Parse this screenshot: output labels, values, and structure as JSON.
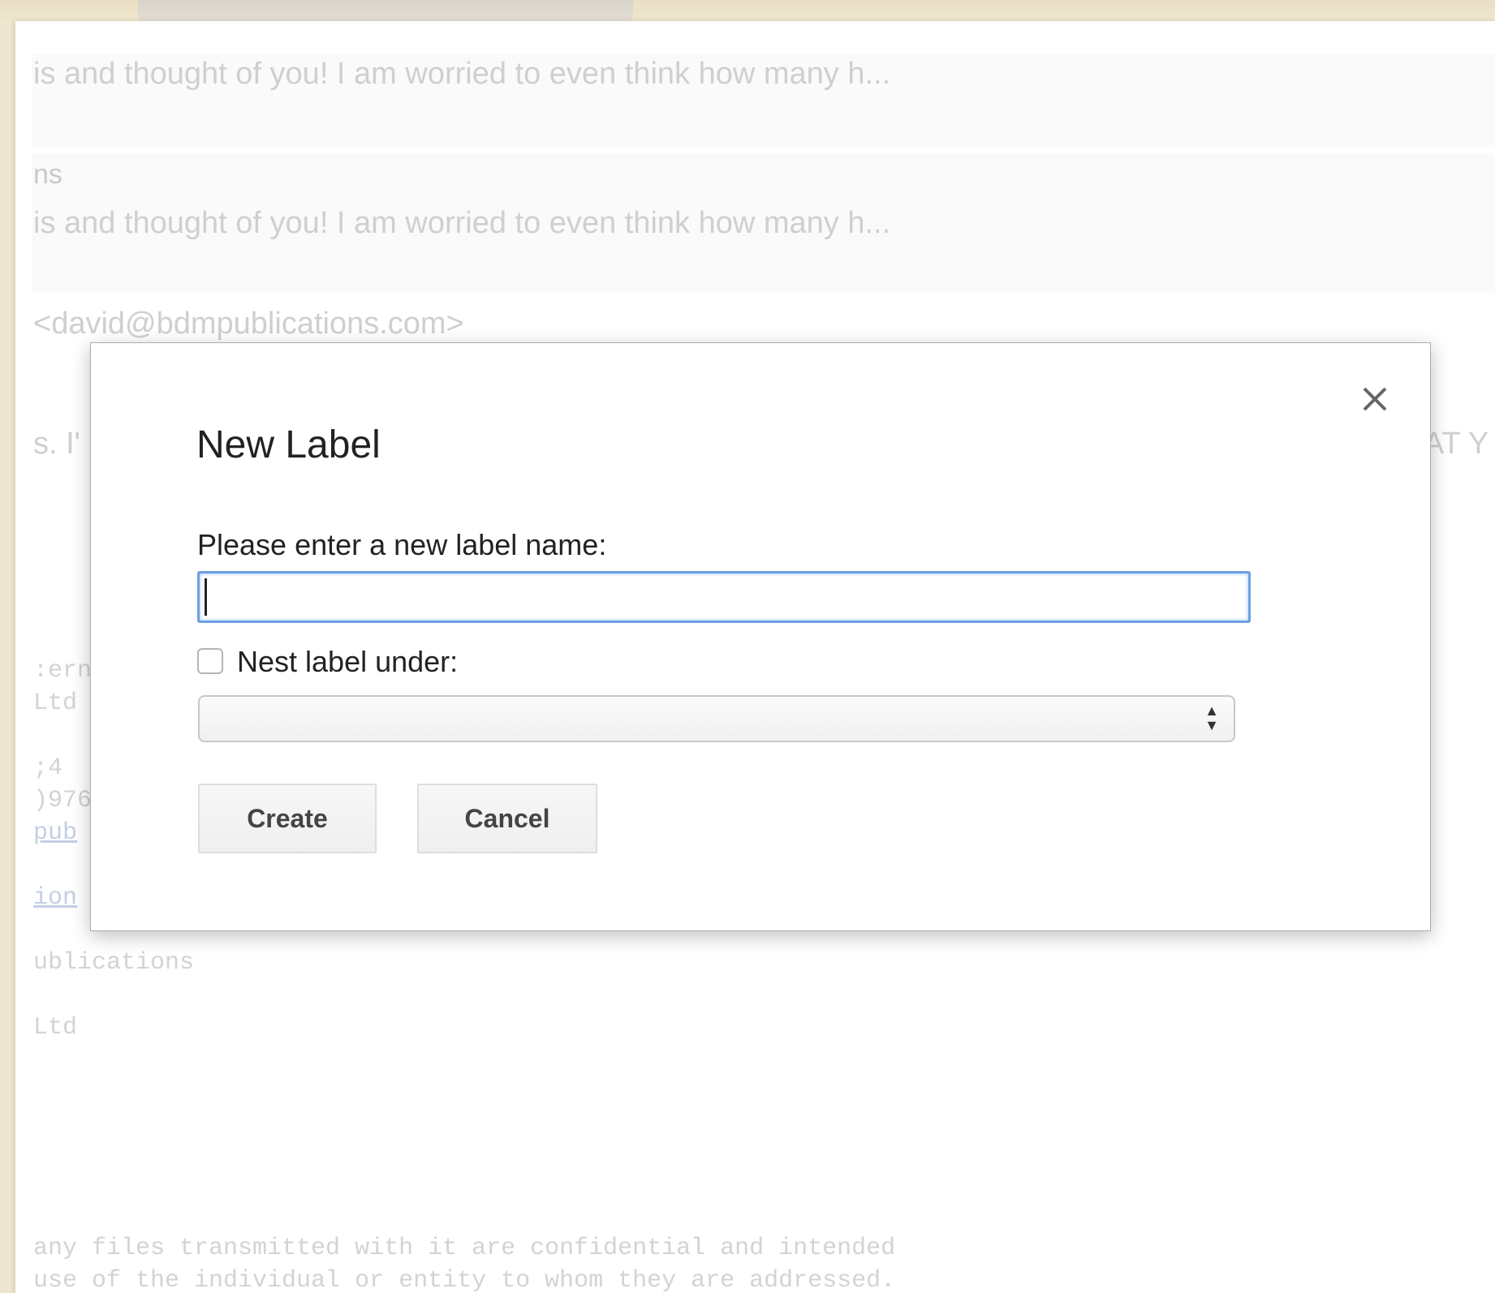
{
  "background": {
    "line1": "is and thought of you! I am worried to even think how many h...",
    "line2": "ns",
    "line3": "is and thought of you! I am worried to even think how many h...",
    "line4": "<david@bdmpublications.com>",
    "line5_left": "s. I'",
    "line5_right": "AT Y",
    "sig_lines": [
      ":ern",
      " Ltd",
      "",
      ";4",
      ")976"
    ],
    "sig_link1": "pub",
    "sig_link2": "ion",
    "sig_line_pub": "ublications",
    "sig_line_ltd": " Ltd",
    "footer1": "any files transmitted with it are confidential and intended",
    "footer2": "use of the individual or entity to whom they are addressed."
  },
  "dialog": {
    "title": "New Label",
    "prompt": "Please enter a new label name:",
    "name_value": "",
    "nest_label": "Nest label under:",
    "nest_checked": false,
    "nest_select_value": "",
    "create_label": "Create",
    "cancel_label": "Cancel",
    "close_icon": "close-icon"
  },
  "colors": {
    "input_focus": "#6ea0e0",
    "frame": "#efe6cf"
  }
}
